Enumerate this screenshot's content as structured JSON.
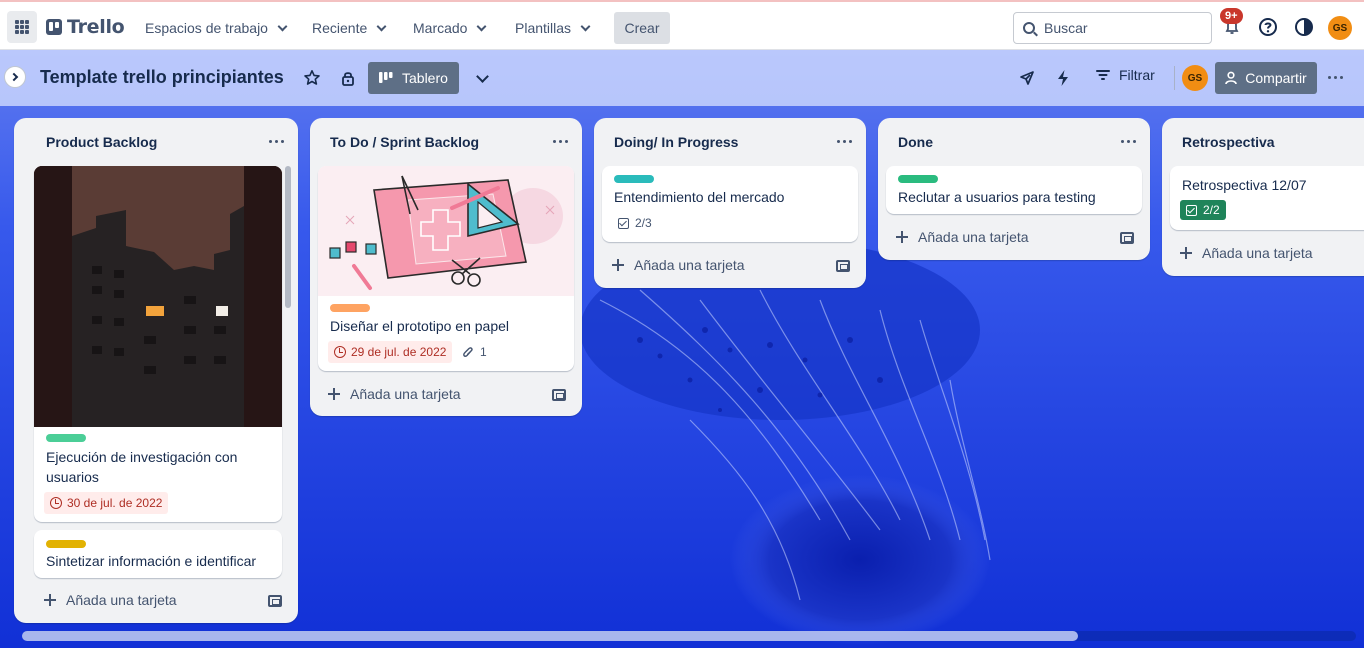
{
  "header": {
    "logo_text": "Trello",
    "nav": [
      "Espacios de trabajo",
      "Reciente",
      "Marcado",
      "Plantillas"
    ],
    "create_label": "Crear",
    "search_placeholder": "Buscar",
    "notification_count": "9+",
    "avatar_initials": "GS"
  },
  "board": {
    "title": "Template trello principiantes",
    "view_label": "Tablero",
    "filter_label": "Filtrar",
    "share_label": "Compartir",
    "member_initials": "GS"
  },
  "lists": [
    {
      "title": "Product Backlog",
      "cards": [
        {
          "label_color": "#4bce97",
          "title": "Ejecución de investigación con usuarios",
          "due": "30 de jul. de 2022",
          "cover": "building-photo"
        },
        {
          "label_color": "#e2b203",
          "title": "Sintetizar información e identificar"
        }
      ],
      "add_label": "Añada una tarjeta"
    },
    {
      "title": "To Do / Sprint Backlog",
      "cards": [
        {
          "label_color": "#fea362",
          "title": "Diseñar el prototipo en papel",
          "due": "29 de jul. de 2022",
          "attachments": "1",
          "cover": "paper-prototype-illustration"
        }
      ],
      "add_label": "Añada una tarjeta"
    },
    {
      "title": "Doing/ In Progress",
      "cards": [
        {
          "label_color": "#2abb7f",
          "title": "Entendimiento del mercado",
          "checklist": "2/3"
        }
      ],
      "add_label": "Añada una tarjeta"
    },
    {
      "title": "Done",
      "cards": [
        {
          "label_color": "#2abb7f",
          "title": "Reclutar a usuarios para testing"
        }
      ],
      "add_label": "Añada una tarjeta"
    },
    {
      "title": "Retrospectiva",
      "cards": [
        {
          "title": "Retrospectiva 12/07",
          "checklist": "2/2"
        }
      ],
      "add_label": "Añada una tarjeta"
    }
  ],
  "colors": {
    "accent_button": "#5e6f86",
    "board_background": "#1d3fd8",
    "due_overdue": "#ae2e24",
    "checklist_complete": "#1f845a"
  }
}
